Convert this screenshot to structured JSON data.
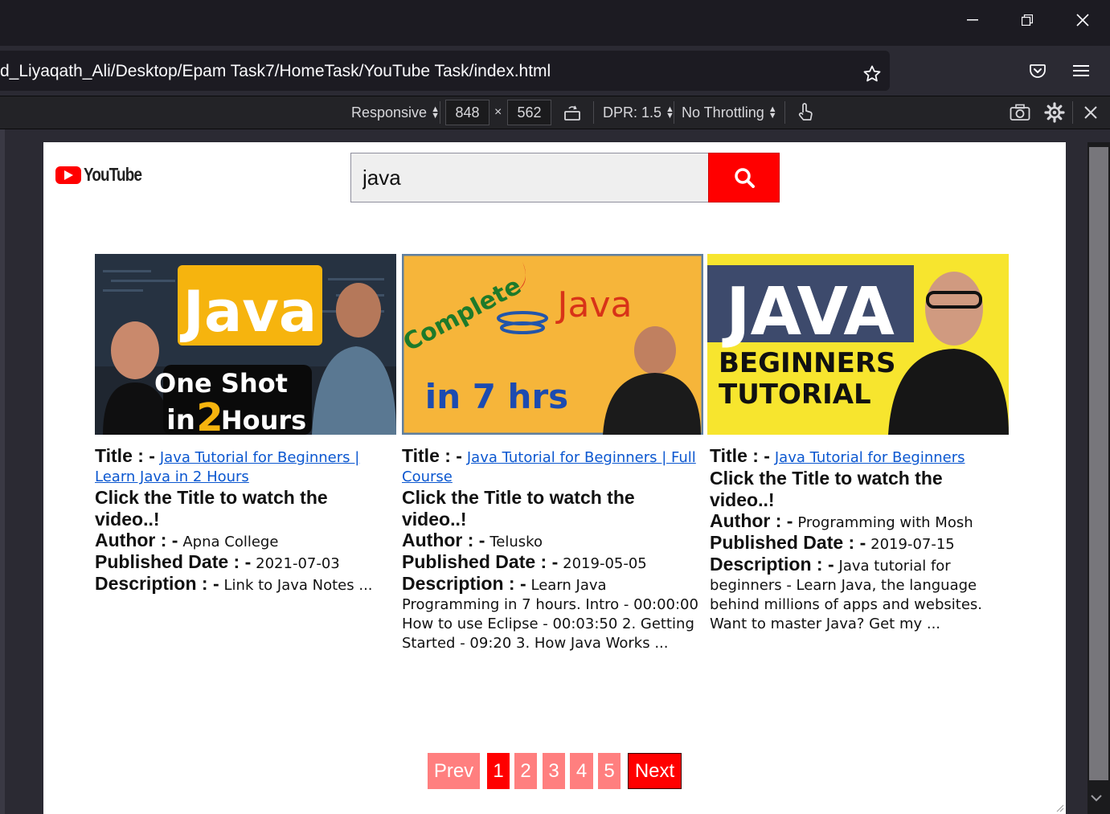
{
  "browser": {
    "url": "d_Liyaqath_Ali/Desktop/Epam Task7/HomeTask/YouTube Task/index.html",
    "window_controls": [
      "minimize-icon",
      "restore-icon",
      "close-icon"
    ],
    "nav_icons": [
      "bookmark-star-icon",
      "pocket-icon",
      "menu-icon"
    ]
  },
  "rdm_toolbar": {
    "device": "Responsive",
    "width": "848",
    "times": "×",
    "height": "562",
    "dpr": "DPR: 1.5",
    "throttling": "No Throttling",
    "icons": [
      "rotate-icon",
      "touch-icon",
      "screenshot-icon",
      "settings-icon",
      "close-icon"
    ]
  },
  "page": {
    "logo_text": "YouTube",
    "search": {
      "value": "java"
    },
    "labels": {
      "title": "Title : -",
      "author": "Author : -",
      "published": "Published Date : -",
      "description": "Description : -",
      "cta": "Click the Title to watch the video..!"
    },
    "videos": [
      {
        "title": "Java Tutorial for Beginners | Learn Java in 2 Hours",
        "author": "Apna College",
        "published": "2021-07-03",
        "description": "Link to Java Notes ...",
        "thumb_text": [
          "Java",
          "One Shot",
          "in",
          "2",
          "Hours"
        ]
      },
      {
        "title": "Java Tutorial for Beginners | Full Course",
        "author": "Telusko",
        "published": "2019-05-05",
        "description": "Learn Java Programming in 7 hours. Intro - 00:00:00 How to use Eclipse - 00:03:50 2. Getting Started - 09:20 3. How Java Works ...",
        "thumb_text": [
          "Complete",
          "Java",
          "in 7 hrs"
        ]
      },
      {
        "title": "Java Tutorial for Beginners",
        "author": "Programming with Mosh",
        "published": "2019-07-15",
        "description": "Java tutorial for beginners - Learn Java, the language behind millions of apps and websites. Want to master Java? Get my ...",
        "thumb_text": [
          "JAVA",
          "BEGINNERS",
          "TUTORIAL"
        ]
      }
    ],
    "pagination": {
      "prev": "Prev",
      "pages": [
        "1",
        "2",
        "3",
        "4",
        "5"
      ],
      "next": "Next",
      "current": "1"
    }
  },
  "colors": {
    "brand_red": "#ff0000",
    "pager_light": "#ff7f7f",
    "link": "#0b57d0"
  }
}
